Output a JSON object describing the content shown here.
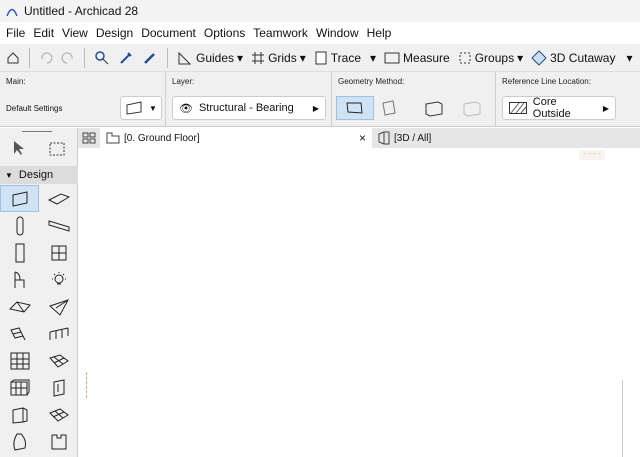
{
  "window": {
    "title": "Untitled - Archicad 28"
  },
  "menu": [
    "File",
    "Edit",
    "View",
    "Design",
    "Document",
    "Options",
    "Teamwork",
    "Window",
    "Help"
  ],
  "toolbar": {
    "guides": "Guides",
    "grids": "Grids",
    "trace": "Trace",
    "measure": "Measure",
    "groups": "Groups",
    "cutaway": "3D Cutaway"
  },
  "info": {
    "main_label": "Main:",
    "default_settings": "Default Settings",
    "layer_label": "Layer:",
    "layer_value": "Structural - Bearing",
    "geometry_label": "Geometry Method:",
    "refline_label": "Reference Line Location:",
    "refline_value": "Core Outside"
  },
  "tabs": [
    {
      "label": "[0. Ground Floor]",
      "close": "×"
    },
    {
      "label": "[3D / All]"
    }
  ],
  "toolbox": {
    "section": "Design",
    "tools": [
      "wall",
      "beam",
      "column",
      "slab",
      "door",
      "window",
      "object",
      "lamp",
      "roof",
      "shell",
      "stair",
      "railing",
      "curtain-wall",
      "mesh",
      "morph",
      "zone",
      "opening",
      "skylight",
      "column-2",
      "beam-2"
    ]
  }
}
